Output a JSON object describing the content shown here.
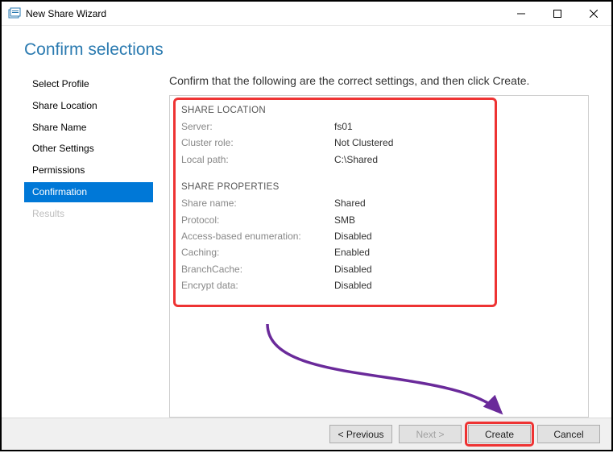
{
  "window": {
    "title": "New Share Wizard"
  },
  "page": {
    "title": "Confirm selections",
    "instruction": "Confirm that the following are the correct settings, and then click Create."
  },
  "sidebar": {
    "items": [
      {
        "label": "Select Profile",
        "active": false,
        "disabled": false
      },
      {
        "label": "Share Location",
        "active": false,
        "disabled": false
      },
      {
        "label": "Share Name",
        "active": false,
        "disabled": false
      },
      {
        "label": "Other Settings",
        "active": false,
        "disabled": false
      },
      {
        "label": "Permissions",
        "active": false,
        "disabled": false
      },
      {
        "label": "Confirmation",
        "active": true,
        "disabled": false
      },
      {
        "label": "Results",
        "active": false,
        "disabled": true
      }
    ]
  },
  "sections": {
    "location": {
      "heading": "SHARE LOCATION",
      "server_label": "Server:",
      "server_value": "fs01",
      "cluster_label": "Cluster role:",
      "cluster_value": "Not Clustered",
      "localpath_label": "Local path:",
      "localpath_value": "C:\\Shared"
    },
    "properties": {
      "heading": "SHARE PROPERTIES",
      "name_label": "Share name:",
      "name_value": "Shared",
      "protocol_label": "Protocol:",
      "protocol_value": "SMB",
      "abe_label": "Access-based enumeration:",
      "abe_value": "Disabled",
      "caching_label": "Caching:",
      "caching_value": "Enabled",
      "branch_label": "BranchCache:",
      "branch_value": "Disabled",
      "encrypt_label": "Encrypt data:",
      "encrypt_value": "Disabled"
    }
  },
  "buttons": {
    "previous": "< Previous",
    "next": "Next >",
    "create": "Create",
    "cancel": "Cancel"
  }
}
